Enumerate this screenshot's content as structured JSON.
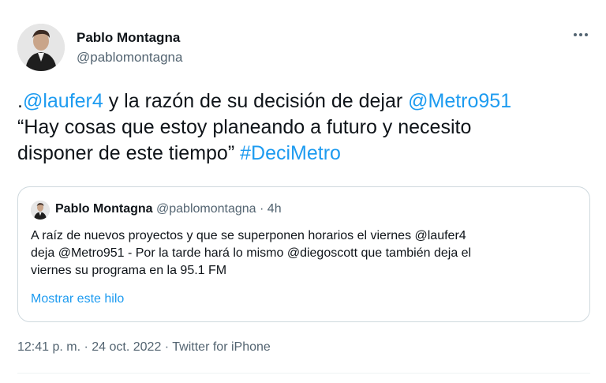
{
  "author": {
    "name": "Pablo Montagna",
    "handle": "@pablomontagna"
  },
  "tweet": {
    "lines": [
      [
        {
          "text": ".",
          "link": false
        },
        {
          "text": "@laufer4",
          "link": true
        },
        {
          "text": " y la razón de su decisión de dejar ",
          "link": false
        },
        {
          "text": "@Metro951",
          "link": true
        }
      ],
      [
        {
          "text": "“Hay cosas que estoy planeando a futuro y necesito",
          "link": false
        }
      ],
      [
        {
          "text": "disponer de este tiempo” ",
          "link": false
        },
        {
          "text": "#DeciMetro",
          "link": true
        }
      ]
    ]
  },
  "quote": {
    "name": "Pablo Montagna",
    "handle": "@pablomontagna",
    "separator": " · ",
    "time": "4h",
    "lines": [
      "A raíz de nuevos proyectos y que se superponen horarios el viernes @laufer4",
      "deja @Metro951 - Por la tarde hará lo mismo @diegoscott que también deja el",
      "viernes su programa en la 95.1 FM"
    ],
    "show_thread": "Mostrar este hilo"
  },
  "meta": {
    "time": "12:41 p. m.",
    "sep1": " · ",
    "date": "24 oct. 2022",
    "sep2": " · ",
    "source": "Twitter for iPhone"
  },
  "icons": {
    "more": "more-horizontal-icon",
    "avatar": "profile-photo"
  },
  "colors": {
    "link": "#1d9bf0",
    "secondary_text": "#536471",
    "primary_text": "#0f1419",
    "border": "#cfd9de"
  }
}
